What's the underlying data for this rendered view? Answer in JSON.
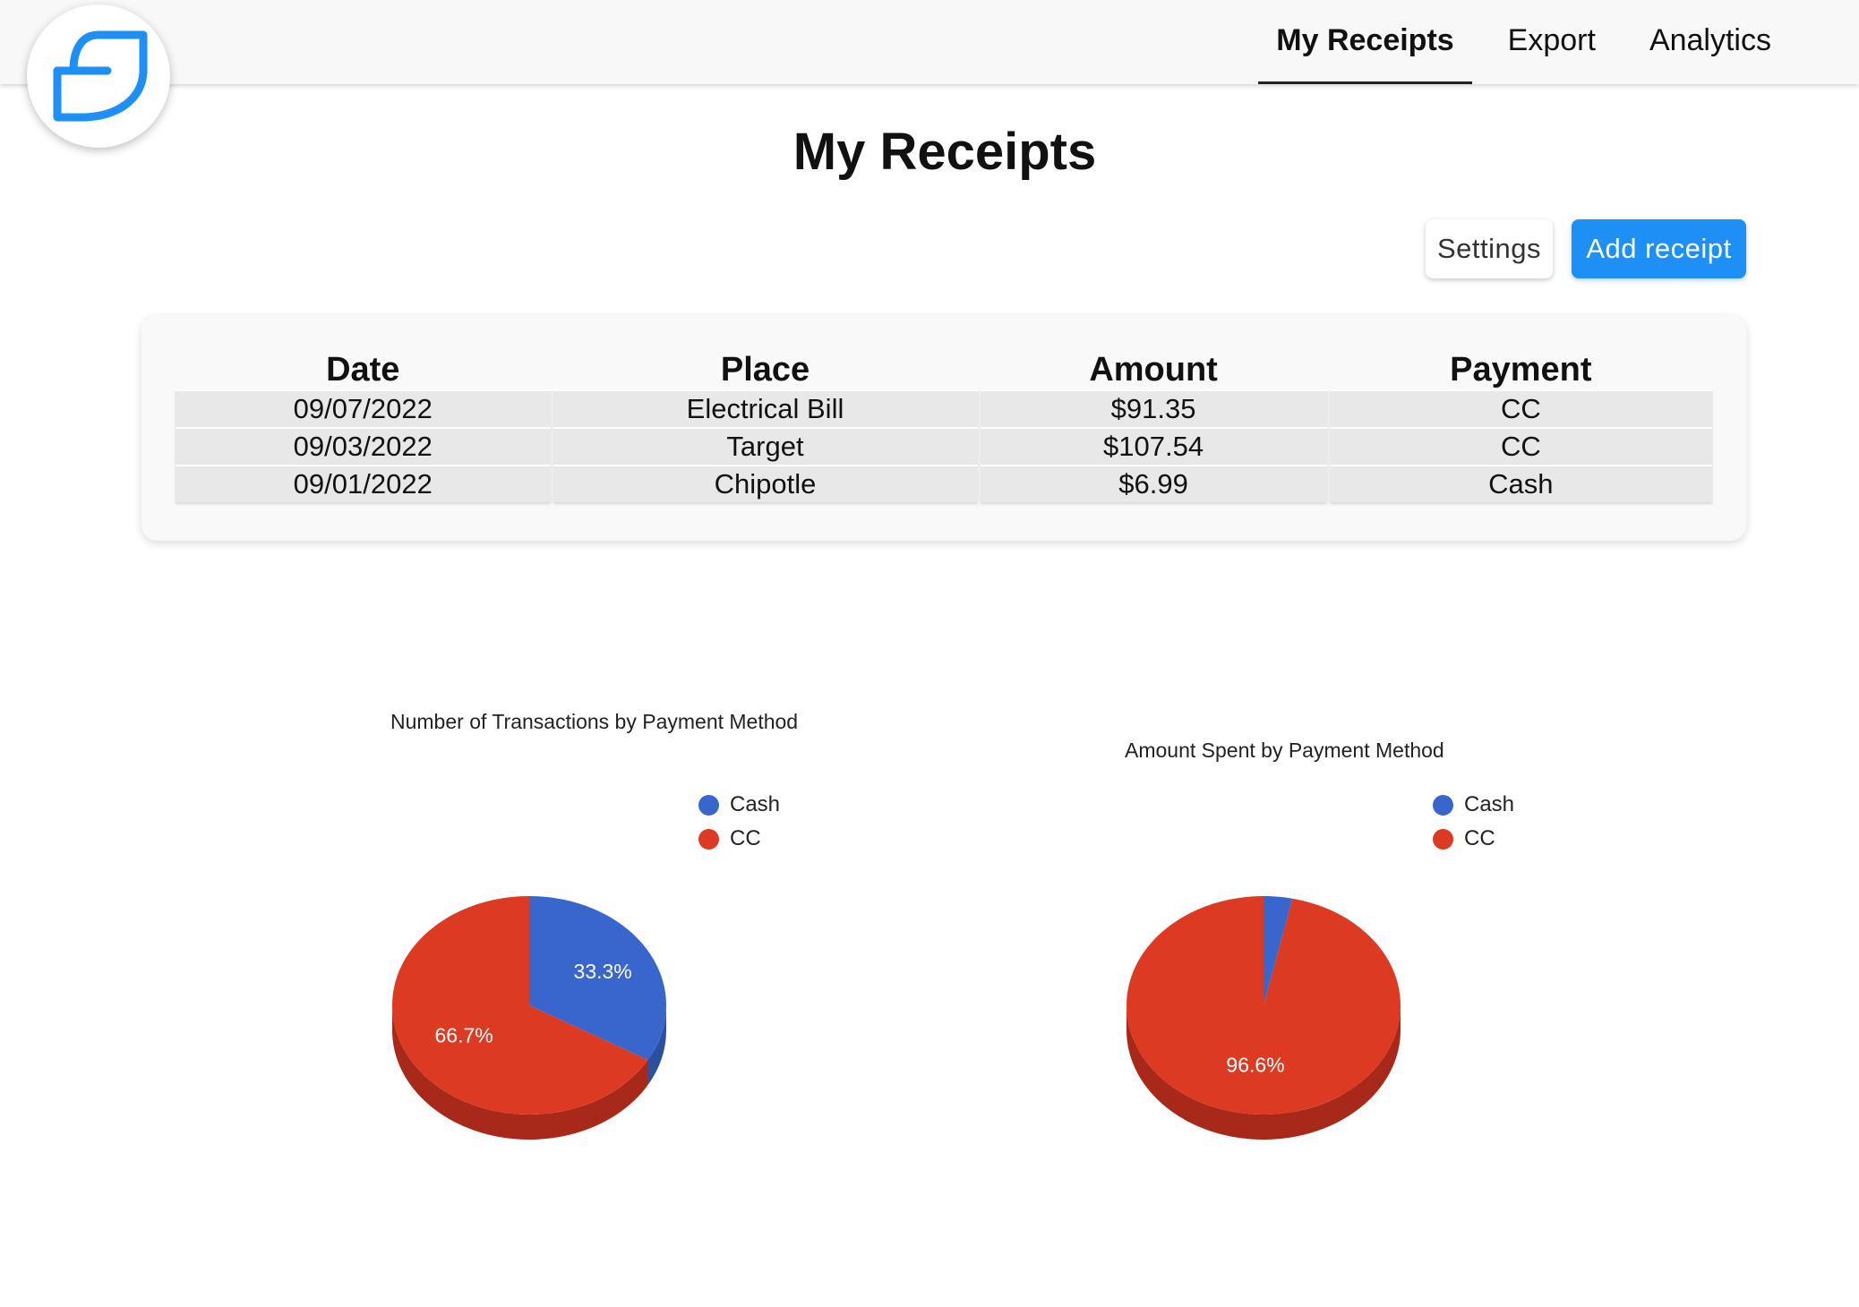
{
  "nav": {
    "items": [
      {
        "label": "My Receipts",
        "active": true
      },
      {
        "label": "Export",
        "active": false
      },
      {
        "label": "Analytics",
        "active": false
      }
    ]
  },
  "page": {
    "title": "My Receipts"
  },
  "actions": {
    "settings_label": "Settings",
    "add_label": "Add receipt"
  },
  "table": {
    "headers": [
      "Date",
      "Place",
      "Amount",
      "Payment"
    ],
    "rows": [
      [
        "09/07/2022",
        "Electrical Bill",
        "$91.35",
        "CC"
      ],
      [
        "09/03/2022",
        "Target",
        "$107.54",
        "CC"
      ],
      [
        "09/01/2022",
        "Chipotle",
        "$6.99",
        "Cash"
      ]
    ]
  },
  "colors": {
    "accent": "#1e8ff5",
    "cash": "#3866cc",
    "cc": "#dc3a22",
    "cash_dark": "#2c50a0",
    "cc_dark": "#a8281a"
  },
  "chart_data": [
    {
      "type": "pie",
      "title": "Number of Transactions by Payment Method",
      "legend": [
        "Cash",
        "CC"
      ],
      "legend_position": "top-right",
      "three_d": true,
      "slices": [
        {
          "label": "Cash",
          "value": 1,
          "percent": 33.3,
          "percent_label": "33.3%"
        },
        {
          "label": "CC",
          "value": 2,
          "percent": 66.7,
          "percent_label": "66.7%"
        }
      ]
    },
    {
      "type": "pie",
      "title": "Amount Spent by Payment Method",
      "legend": [
        "Cash",
        "CC"
      ],
      "legend_position": "top-right",
      "three_d": true,
      "slices": [
        {
          "label": "Cash",
          "value": 6.99,
          "percent": 3.4,
          "percent_label": ""
        },
        {
          "label": "CC",
          "value": 198.89,
          "percent": 96.6,
          "percent_label": "96.6%"
        }
      ]
    }
  ]
}
